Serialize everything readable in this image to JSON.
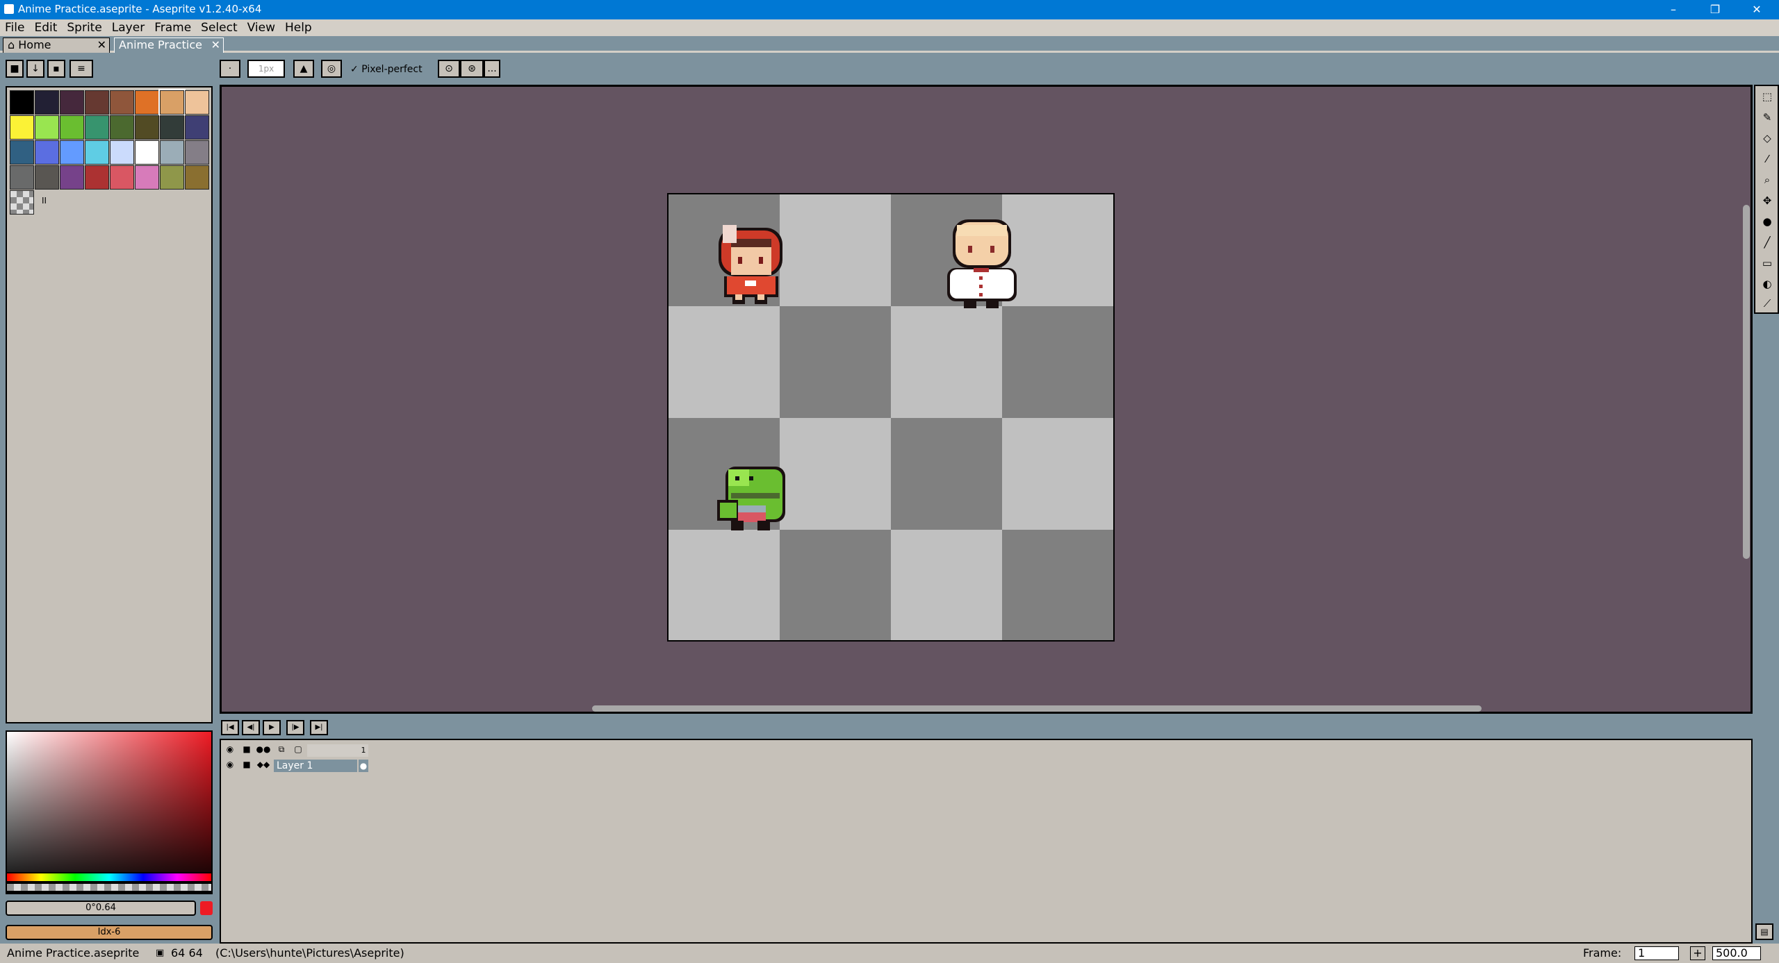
{
  "window": {
    "title": "Anime Practice.aseprite - Aseprite v1.2.40-x64",
    "minimize": "–",
    "maximize": "❐",
    "close": "✕"
  },
  "menu": [
    "File",
    "Edit",
    "Sprite",
    "Layer",
    "Frame",
    "Select",
    "View",
    "Help"
  ],
  "tabs": [
    {
      "label": "Home",
      "icon": "home-icon"
    },
    {
      "label": "Anime Practice",
      "active": true
    }
  ],
  "toolbar": {
    "brush_size": "1px",
    "pixel_perfect_label": "Pixel-perfect",
    "pixel_perfect_checked": true,
    "more": "..."
  },
  "palette": {
    "colors": [
      "#000000",
      "#222034",
      "#45283c",
      "#663931",
      "#8f563b",
      "#df7126",
      "#d9a066",
      "#eec39a",
      "#fbf236",
      "#99e550",
      "#6abe30",
      "#37946e",
      "#4b692f",
      "#524b24",
      "#323c39",
      "#3f3f74",
      "#306082",
      "#5b6ee1",
      "#639bff",
      "#5fcde4",
      "#cbdbfc",
      "#ffffff",
      "#9badb7",
      "#847e87",
      "#696a6a",
      "#595652",
      "#76428a",
      "#ac3232",
      "#d95763",
      "#d77bba",
      "#8f974a",
      "#8a6f30"
    ],
    "selected_index": 6
  },
  "color_bar": {
    "fg_entry": "0°0.64",
    "bg_entry": "Idx-6",
    "fg_color": "#c8c2ba",
    "bg_color": "#d9a066",
    "warning_color": "#ee1b24"
  },
  "layers": {
    "frame_number": "1",
    "layer_name": "Layer 1"
  },
  "status": {
    "filename": "Anime Practice.aseprite",
    "size": "64 64",
    "path": "(C:\\Users\\hunte\\Pictures\\Aseprite)",
    "frame_label": "Frame:",
    "frame_value": "1",
    "zoom": "500.0"
  },
  "colors": {
    "accent": "#0078d4",
    "canvas_bg": "#645461",
    "panel": "#c6c1b9",
    "checker_dark": "#808080",
    "checker_light": "#c0c0c0"
  }
}
